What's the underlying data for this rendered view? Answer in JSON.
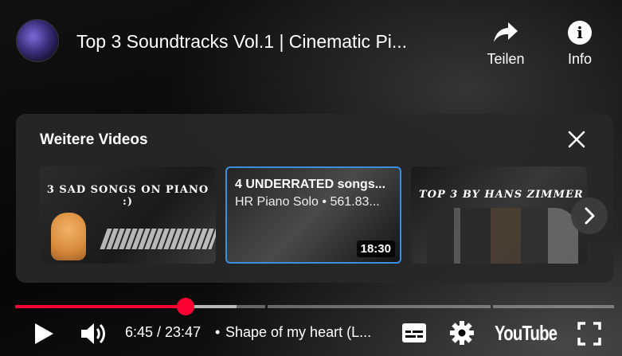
{
  "video": {
    "title": "Top 3 Soundtracks Vol.1 | Cinematic Pi..."
  },
  "top_actions": {
    "share_label": "Teilen",
    "info_label": "Info"
  },
  "more_videos": {
    "heading": "Weitere Videos",
    "cards": [
      {
        "thumb_text": "3 SAD SONGS ON PIANO :)"
      },
      {
        "title": "4 UNDERRATED songs...",
        "subtitle": "HR Piano Solo • 561.83...",
        "duration": "18:30"
      },
      {
        "thumb_text": "TOP 3 BY HANS ZIMMER"
      }
    ]
  },
  "player": {
    "current_time": "6:45",
    "duration": "23:47",
    "time_display": "6:45 / 23:47",
    "separator": "•",
    "chapter": "Shape of my heart (L...",
    "brand": "YouTube",
    "played_fraction": 0.284,
    "accent_color": "#ff0033",
    "focus_color": "#3e8ede"
  }
}
